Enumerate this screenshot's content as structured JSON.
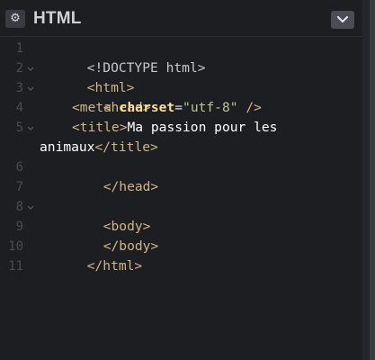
{
  "panel": {
    "title": "HTML",
    "settings_icon": "gear-icon",
    "collapse_icon": "chevron-down-icon"
  },
  "editor": {
    "line_numbers": [
      "1",
      "2",
      "3",
      "4",
      "5",
      "6",
      "7",
      "8",
      "9",
      "10",
      "11"
    ],
    "lines": {
      "l1": {
        "doctype": "<!DOCTYPE html>"
      },
      "l2": {
        "tag": "<html>"
      },
      "l3": {
        "tag": "<head>"
      },
      "l4": {
        "tag_open": "<meta ",
        "attr": "charset",
        "eq": "=",
        "str": "\"utf-8\"",
        "tag_close": " />"
      },
      "l5": {
        "tag_open": "<title>",
        "text": "Ma passion pour les"
      },
      "l5b": {
        "text": "animaux",
        "tag_close": "</title>"
      },
      "l6": {
        "tag": "</head>"
      },
      "l8": {
        "tag": "<body>"
      },
      "l9": {
        "tag": "</body>"
      },
      "l10": {
        "tag": "</html>"
      }
    }
  }
}
